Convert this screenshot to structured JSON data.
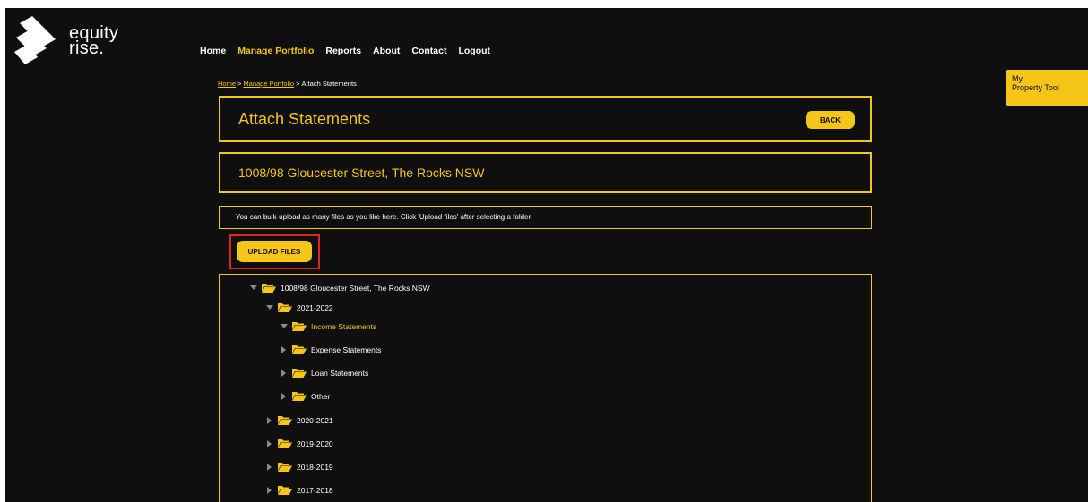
{
  "brand": {
    "line1": "equity",
    "line2": "rise."
  },
  "nav": [
    {
      "label": "Home",
      "active": false
    },
    {
      "label": "Manage Portfolio",
      "active": true
    },
    {
      "label": "Reports",
      "active": false
    },
    {
      "label": "About",
      "active": false
    },
    {
      "label": "Contact",
      "active": false
    },
    {
      "label": "Logout",
      "active": false
    }
  ],
  "breadcrumb": {
    "home": "Home",
    "sep": ">",
    "portfolio": "Manage Portfolio",
    "current": "Attach Statements"
  },
  "side_tab": {
    "line1": "My",
    "line2": "Property Tool"
  },
  "page": {
    "title": "Attach Statements",
    "back_label": "BACK",
    "address": "1008/98 Gloucester Street, The Rocks NSW",
    "info": "You can bulk-upload as many files as you like here. Click 'Upload files' after selecting a folder.",
    "upload_label": "UPLOAD FILES"
  },
  "tree": [
    {
      "label": "1008/98 Gloucester Street, The Rocks NSW",
      "level": 0,
      "expanded": true,
      "selected": false
    },
    {
      "label": "2021-2022",
      "level": 1,
      "expanded": true,
      "selected": false
    },
    {
      "label": "Income Statements",
      "level": 2,
      "expanded": true,
      "selected": true
    },
    {
      "label": "Expense Statements",
      "level": 2,
      "expanded": false,
      "selected": false
    },
    {
      "label": "Loan Statements",
      "level": 2,
      "expanded": false,
      "selected": false
    },
    {
      "label": "Other",
      "level": 2,
      "expanded": false,
      "selected": false
    },
    {
      "label": "2020-2021",
      "level": 1,
      "expanded": false,
      "selected": false
    },
    {
      "label": "2019-2020",
      "level": 1,
      "expanded": false,
      "selected": false
    },
    {
      "label": "2018-2019",
      "level": 1,
      "expanded": false,
      "selected": false
    },
    {
      "label": "2017-2018",
      "level": 1,
      "expanded": false,
      "selected": false
    }
  ],
  "colors": {
    "accent": "#f5c518",
    "background": "#0f0f0f",
    "highlight": "#e02424",
    "text": "#ffffff"
  }
}
